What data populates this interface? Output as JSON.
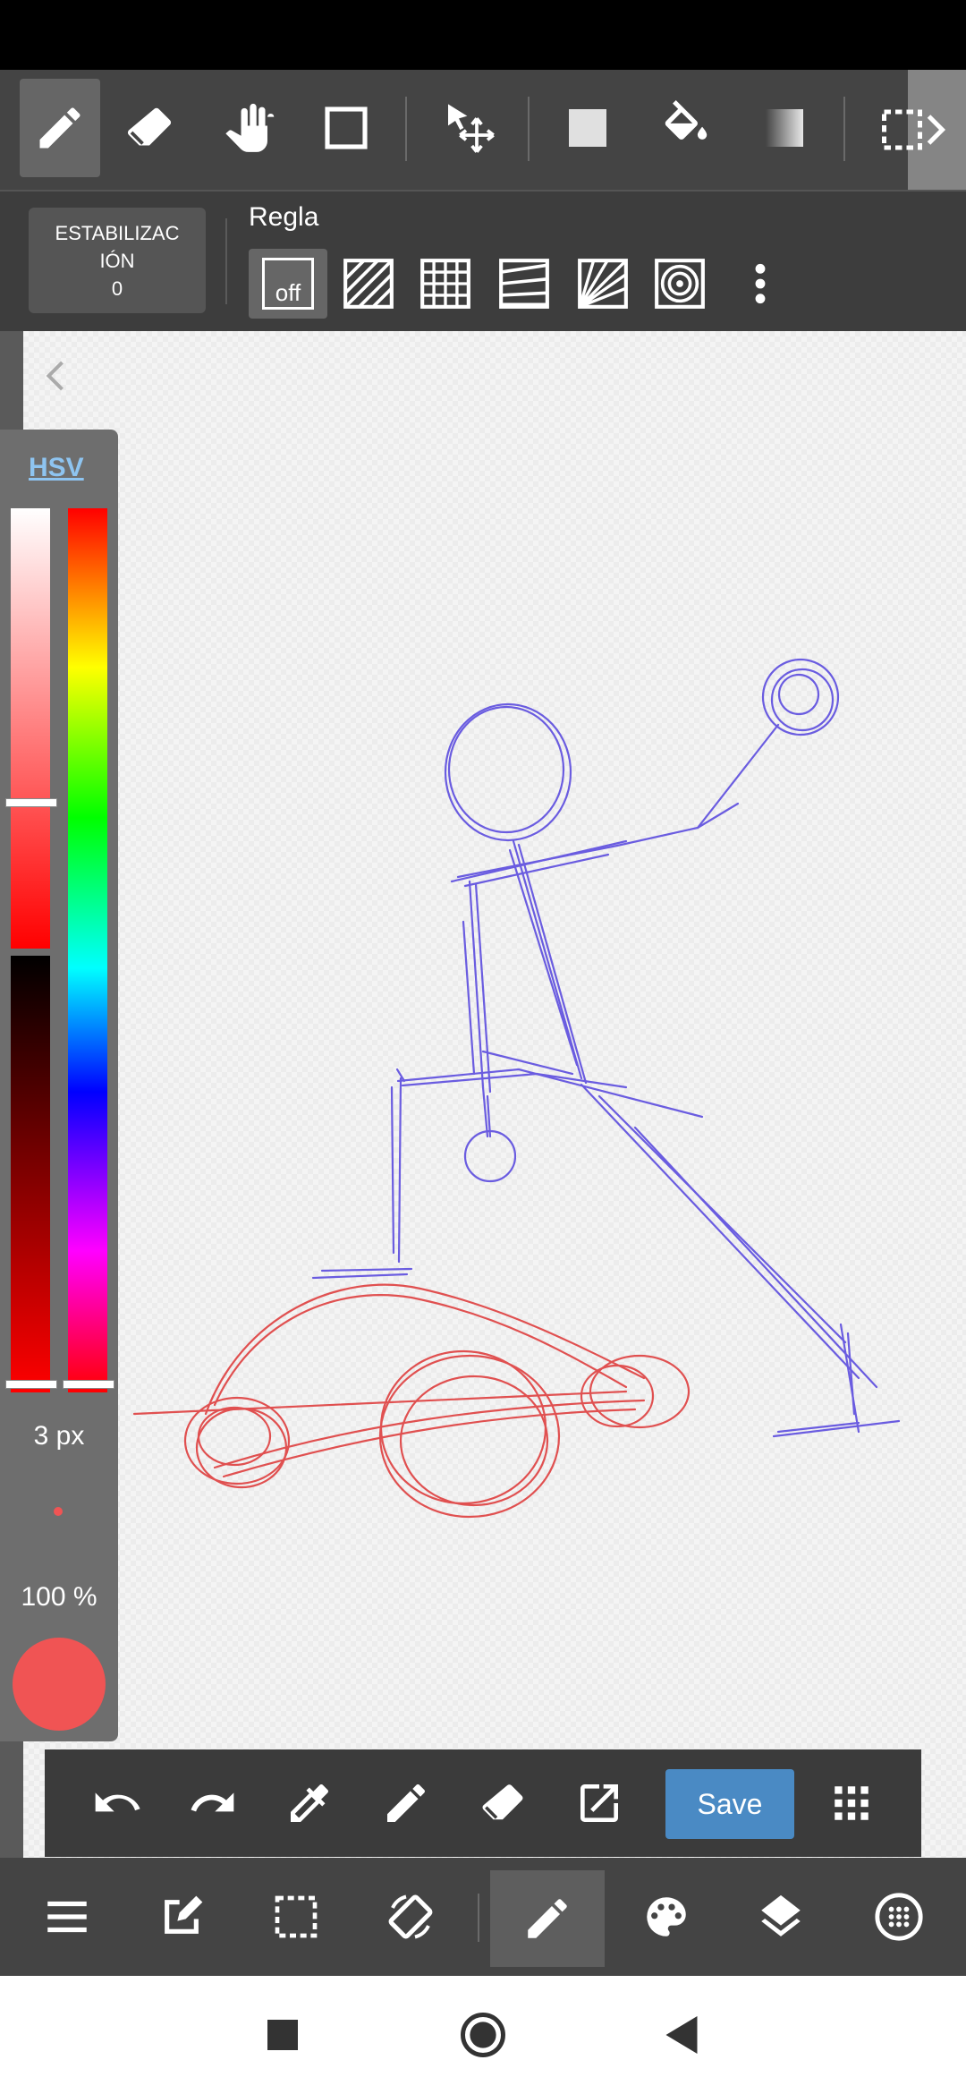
{
  "toolbar": {
    "tools": [
      {
        "icon": "pen-icon",
        "active": true
      },
      {
        "icon": "eraser-icon"
      },
      {
        "icon": "hand-icon"
      },
      {
        "icon": "rectangle-icon"
      },
      {
        "icon": "move-icon"
      },
      {
        "icon": "fill-square-icon"
      },
      {
        "icon": "paint-bucket-icon"
      },
      {
        "icon": "gradient-icon"
      },
      {
        "icon": "select-more-icon"
      }
    ]
  },
  "subtoolbar": {
    "stabilization_label_1": "ESTABILIZAC",
    "stabilization_label_2": "IÓN",
    "stabilization_value": "0",
    "ruler_title": "Regla",
    "ruler_off": "off",
    "ruler_options": [
      "parallel-lines-icon",
      "grid-icon",
      "perspective-lines-icon",
      "radial-lines-icon",
      "concentric-circles-icon"
    ]
  },
  "color_panel": {
    "mode": "HSV",
    "brush_size": "3 px",
    "opacity": "100 %",
    "current_color": "#f05454",
    "saturation_level": 0.68,
    "value_level": 1.0,
    "hue_level": 1.0
  },
  "actions": {
    "save_label": "Save",
    "icons": [
      "undo-icon",
      "redo-icon",
      "eyedropper-icon",
      "pencil-icon",
      "eraser-icon",
      "open-external-icon",
      "grid-dots-icon"
    ]
  },
  "bottom_nav": {
    "icons": [
      "menu-icon",
      "edit-icon",
      "selection-icon",
      "rotate-icon",
      "brush-icon",
      "palette-icon",
      "layers-icon",
      "dot-grid-icon"
    ]
  },
  "colors": {
    "accent_blue": "#4a8ac4",
    "sketch_blue": "#6a5ce0",
    "sketch_red": "#e05050"
  }
}
